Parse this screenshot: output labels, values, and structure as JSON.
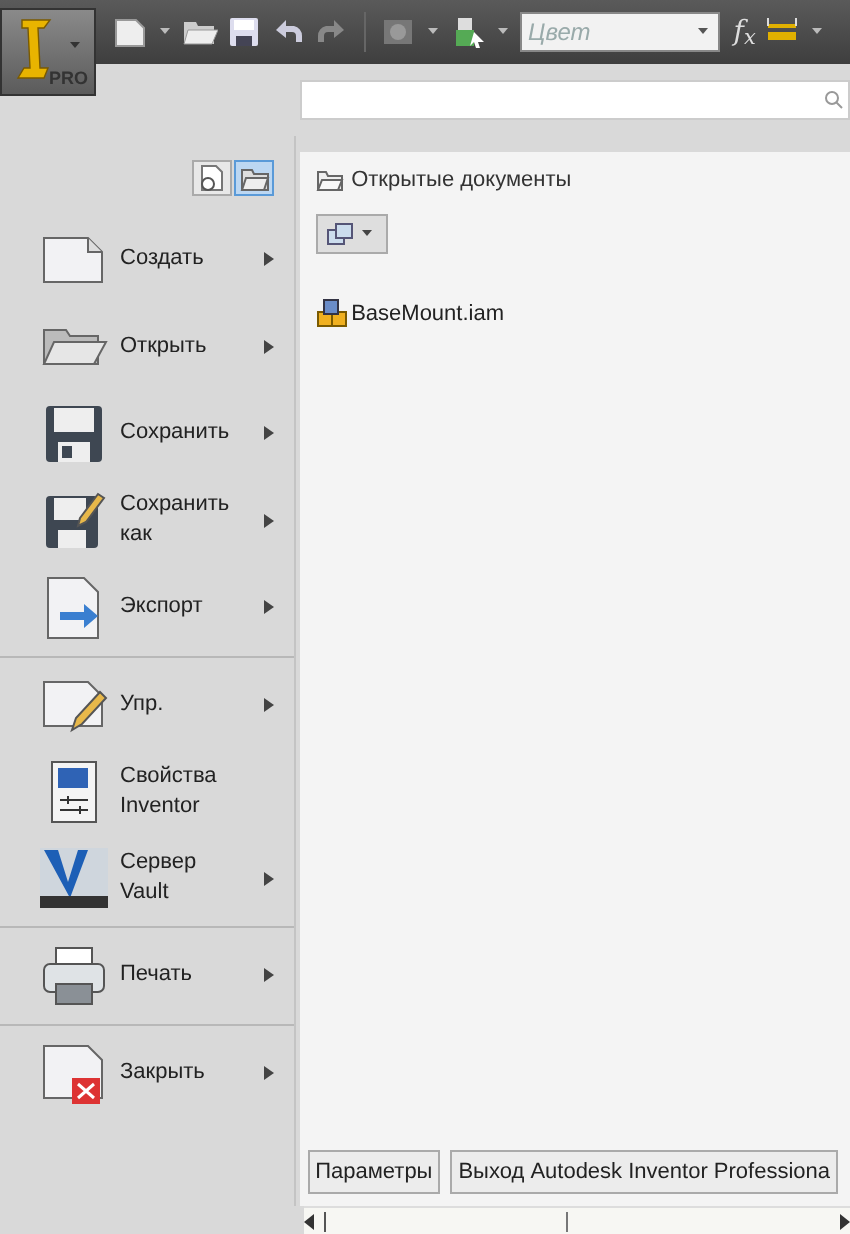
{
  "app_button": {
    "badge": "PRO"
  },
  "toolbar": {
    "color_combo": {
      "placeholder": "Цвет"
    },
    "formula_label": "f$_{x}$"
  },
  "view_toggles": [
    {
      "selected": false
    },
    {
      "selected": true
    }
  ],
  "menu": {
    "groups": [
      [
        {
          "label": "Создать",
          "submenu": true
        },
        {
          "label": "Открыть",
          "submenu": true
        },
        {
          "label": "Сохранить",
          "submenu": true
        },
        {
          "label": "Сохранить как",
          "submenu": true
        },
        {
          "label": "Экспорт",
          "submenu": true
        }
      ],
      [
        {
          "label": "Упр.",
          "submenu": true
        },
        {
          "label": "Свойства Inventor",
          "submenu": false
        },
        {
          "label": "Сервер Vault",
          "submenu": true
        }
      ],
      [
        {
          "label": "Печать",
          "submenu": true
        }
      ],
      [
        {
          "label": "Закрыть",
          "submenu": true
        }
      ]
    ]
  },
  "documents_panel": {
    "heading": "Открытые документы",
    "documents": [
      {
        "name": "BaseMount.iam"
      }
    ]
  },
  "footer_buttons": [
    "Параметры",
    "Выход Autodesk Inventor Professiona"
  ]
}
